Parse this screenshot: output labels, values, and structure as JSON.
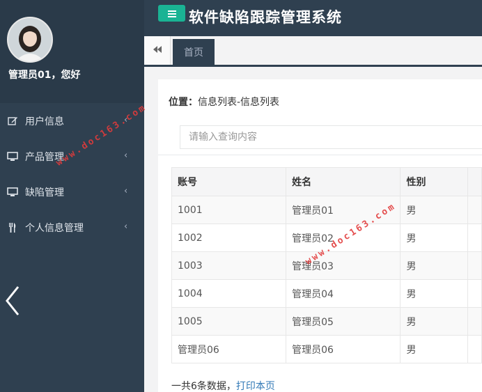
{
  "app": {
    "title": "软件缺陷跟踪管理系统"
  },
  "profile": {
    "greeting": "管理员01，您好"
  },
  "sidebar": {
    "items": [
      {
        "label": "用户信息",
        "icon": "edit-icon"
      },
      {
        "label": "产品管理",
        "icon": "monitor-icon"
      },
      {
        "label": "缺陷管理",
        "icon": "monitor-icon"
      },
      {
        "label": "个人信息管理",
        "icon": "cutlery-icon"
      }
    ]
  },
  "tabs": [
    {
      "label": "首页"
    }
  ],
  "breadcrumb": {
    "prefix": "位置：",
    "path": "信息列表-信息列表"
  },
  "search": {
    "placeholder": "请输入查询内容",
    "value": ""
  },
  "table": {
    "headers": [
      "账号",
      "姓名",
      "性别",
      ""
    ],
    "rows": [
      [
        "1001",
        "管理员01",
        "男",
        ""
      ],
      [
        "1002",
        "管理员02",
        "男",
        ""
      ],
      [
        "1003",
        "管理员03",
        "男",
        ""
      ],
      [
        "1004",
        "管理员04",
        "男",
        ""
      ],
      [
        "1005",
        "管理员05",
        "男",
        ""
      ],
      [
        "管理员06",
        "管理员06",
        "男",
        ""
      ]
    ]
  },
  "summary": {
    "count_text": "一共6条数据，",
    "print_link": "打印本页"
  },
  "watermark": {
    "text": "www.doc163.com"
  },
  "colors": {
    "sidebar": "#2f4050",
    "accent": "#1ab394",
    "link": "#337ab7",
    "watermark": "#e23b3b"
  }
}
